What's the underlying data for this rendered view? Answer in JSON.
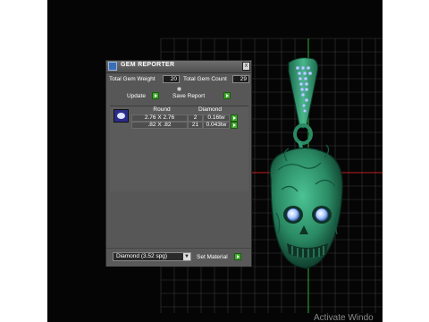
{
  "panel": {
    "title": "GEM REPORTER",
    "close_label": "x",
    "total_gem_weight_label": "Total Gem Weight",
    "total_gem_weight_value": "20",
    "total_gem_count_label": "Total Gem Count",
    "total_gem_count_value": "29",
    "update_label": "Update",
    "save_report_label": "Save Report"
  },
  "table": {
    "headers": [
      "Round",
      "Diamond"
    ],
    "rows": [
      {
        "size": "2.76 X 2.76",
        "count": "2",
        "weight": "0.16tw"
      },
      {
        "size": ".82 X .82",
        "count": "21",
        "weight": "0.043tw"
      }
    ]
  },
  "material": {
    "selected": "Diamond   (3.52 spg)",
    "set_material_label": "Set Material"
  },
  "watermark": "Activate Windo",
  "colors": {
    "model": "#2f9a72",
    "gems": "#a9c8ff",
    "grid": "#3a3a3a",
    "panel": "#575757",
    "go_button": "#3faa2c"
  }
}
